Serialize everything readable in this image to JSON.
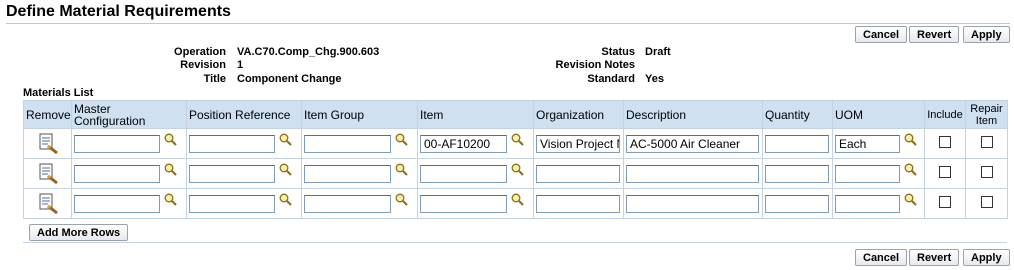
{
  "page": {
    "title": "Define Material Requirements",
    "buttons": {
      "cancel": "Cancel",
      "revert": "Revert",
      "apply": "Apply"
    }
  },
  "header": {
    "operation_label": "Operation",
    "operation_value": "VA.C70.Comp_Chg.900.603",
    "revision_label": "Revision",
    "revision_value": "1",
    "title_label": "Title",
    "title_value": "Component Change",
    "status_label": "Status",
    "status_value": "Draft",
    "revision_notes_label": "Revision Notes",
    "revision_notes_value": "",
    "standard_label": "Standard",
    "standard_value": "Yes"
  },
  "materials": {
    "section_label": "Materials List",
    "columns": {
      "remove": "Remove",
      "master_configuration": "Master Configuration",
      "position_reference": "Position Reference",
      "item_group": "Item Group",
      "item": "Item",
      "organization": "Organization",
      "description": "Description",
      "quantity": "Quantity",
      "uom": "UOM",
      "include": "Include",
      "repair_item": "Repair Item"
    },
    "rows": [
      {
        "master_configuration": "",
        "position_reference": "",
        "item_group": "",
        "item": "00-AF10200",
        "organization": "Vision Project M",
        "description": "AC-5000 Air Cleaner",
        "quantity": "",
        "uom": "Each",
        "include": false,
        "repair_item": false
      },
      {
        "master_configuration": "",
        "position_reference": "",
        "item_group": "",
        "item": "",
        "organization": "",
        "description": "",
        "quantity": "",
        "uom": "",
        "include": false,
        "repair_item": false
      },
      {
        "master_configuration": "",
        "position_reference": "",
        "item_group": "",
        "item": "",
        "organization": "",
        "description": "",
        "quantity": "",
        "uom": "",
        "include": false,
        "repair_item": false
      }
    ],
    "add_more_rows": "Add More Rows"
  },
  "icons": {
    "remove": "remove-record-icon",
    "lov": "magnifier-search-icon"
  },
  "colors": {
    "table_header_bg": "#cfe0f1",
    "table_border": "#c3d3e3"
  }
}
